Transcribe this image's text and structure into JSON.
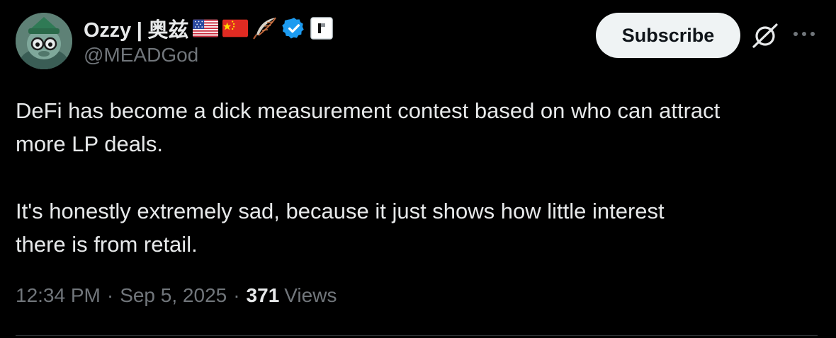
{
  "author": {
    "display_name": "Ozzy | 奥兹",
    "handle": "@MEADGod",
    "badges": [
      "us-flag-icon",
      "china-flag-icon",
      "feather-icon",
      "verified-badge-icon",
      "affiliate-badge-icon"
    ]
  },
  "actions": {
    "subscribe_label": "Subscribe",
    "grok_icon": "grok-icon",
    "more_icon": "more-icon"
  },
  "tweet": {
    "paragraphs": [
      "DeFi has become a dick measurement contest based on who can attract\nmore LP deals.",
      "It's honestly extremely sad, because it just shows how little interest\nthere is from retail."
    ],
    "time": "12:34 PM",
    "date": "Sep 5, 2025",
    "separator": "·",
    "views_count": "371",
    "views_label": "Views"
  },
  "colors": {
    "background": "#000000",
    "text": "#e7e9ea",
    "secondary": "#71767b",
    "verified": "#1d9bf0",
    "button_bg": "#eff3f4"
  }
}
